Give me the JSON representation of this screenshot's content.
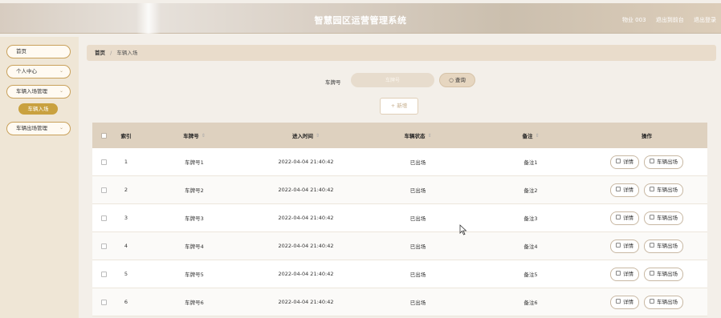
{
  "header": {
    "title": "智慧园区运营管理系统",
    "user": "物业 003",
    "back_home": "退出到前台",
    "logout": "退出登录"
  },
  "sidebar": {
    "items": [
      {
        "label": "首页",
        "has_children": false
      },
      {
        "label": "个人中心",
        "has_children": true
      },
      {
        "label": "车辆入场管理",
        "has_children": true
      },
      {
        "label": "车辆出场管理",
        "has_children": true
      }
    ],
    "active_sub": "车辆入场"
  },
  "breadcrumb": {
    "home": "首页",
    "sep": "/",
    "current": "车辆入场"
  },
  "search": {
    "label": "车牌号",
    "placeholder": "车牌号",
    "button": "查询"
  },
  "add_button": "+ 新增",
  "table": {
    "columns": [
      "索引",
      "车牌号",
      "进入时间",
      "车辆状态",
      "备注",
      "操作"
    ],
    "sortable": [
      false,
      true,
      true,
      true,
      true,
      false
    ],
    "rows": [
      {
        "index": "1",
        "plate": "车牌号1",
        "time": "2022-04-04 21:40:42",
        "status": "已出场",
        "note": "备注1"
      },
      {
        "index": "2",
        "plate": "车牌号2",
        "time": "2022-04-04 21:40:42",
        "status": "已出场",
        "note": "备注2"
      },
      {
        "index": "3",
        "plate": "车牌号3",
        "time": "2022-04-04 21:40:42",
        "status": "已出场",
        "note": "备注3"
      },
      {
        "index": "4",
        "plate": "车牌号4",
        "time": "2022-04-04 21:40:42",
        "status": "已出场",
        "note": "备注4"
      },
      {
        "index": "5",
        "plate": "车牌号5",
        "time": "2022-04-04 21:40:42",
        "status": "已出场",
        "note": "备注5"
      },
      {
        "index": "6",
        "plate": "车牌号6",
        "time": "2022-04-04 21:40:42",
        "status": "已出场",
        "note": "备注6"
      }
    ],
    "actions": {
      "detail": "详情",
      "exit": "车辆出场"
    },
    "sort_glyph": "⇕"
  },
  "colors": {
    "accent": "#c9a13f",
    "header_bg": "#d7ccc0",
    "table_head": "#ded1bf"
  }
}
